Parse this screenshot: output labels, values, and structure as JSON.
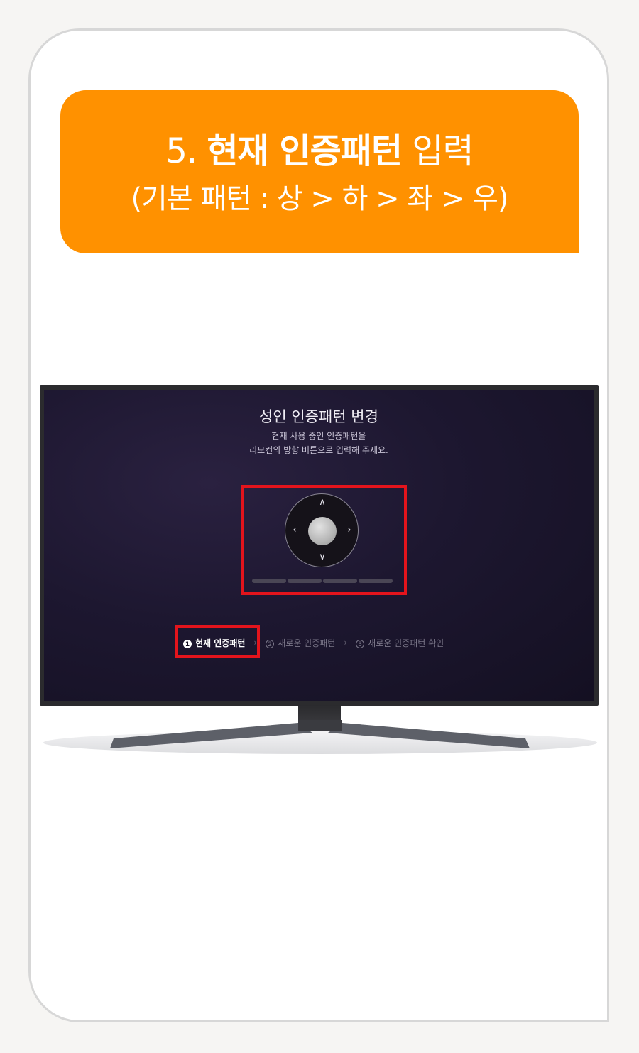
{
  "banner": {
    "step_number": "5.",
    "title_bold": "현재 인증패턴",
    "title_light": "입력",
    "subtitle": "(기본 패턴 : 상 > 하 > 좌 > 우)"
  },
  "screen": {
    "title": "성인 인증패턴 변경",
    "description_line1": "현재 사용 중인 인증패턴을",
    "description_line2": "리모컨의 방향 버튼으로 입력해 주세요.",
    "pattern_progress_segments": 4,
    "steps": [
      {
        "number": "1",
        "label": "현재 인증패턴",
        "active": true
      },
      {
        "number": "2",
        "label": "새로운 인증패턴",
        "active": false
      },
      {
        "number": "3",
        "label": "새로운 인증패턴 확인",
        "active": false
      }
    ]
  },
  "colors": {
    "banner": "#ff9100",
    "highlight": "#e3141c",
    "screen_background": "#1d1730"
  },
  "icons": {
    "up": "chevron-up-icon",
    "down": "chevron-down-icon",
    "left": "chevron-left-icon",
    "right": "chevron-right-icon",
    "step_separator": "chevron-right-icon"
  }
}
